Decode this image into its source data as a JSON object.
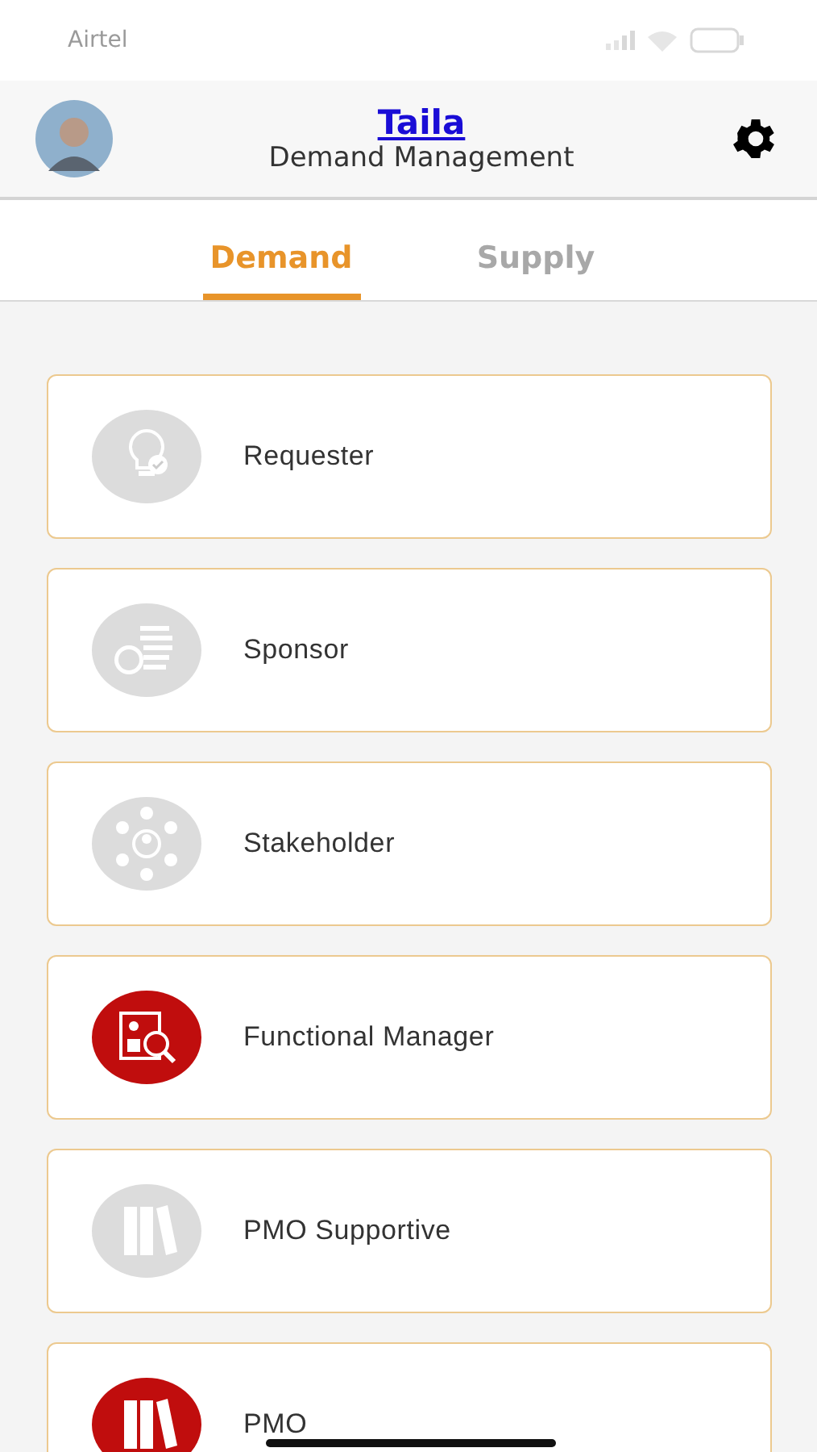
{
  "status_bar": {
    "carrier": "Airtel"
  },
  "header": {
    "user_name": "Taila",
    "subtitle": "Demand Management"
  },
  "tabs": [
    {
      "label": "Demand",
      "selected": true
    },
    {
      "label": "Supply",
      "selected": false
    }
  ],
  "roles": [
    {
      "label": "Requester",
      "kind": "bulb",
      "active": false
    },
    {
      "label": "Sponsor",
      "kind": "coins",
      "active": false
    },
    {
      "label": "Stakeholder",
      "kind": "people",
      "active": false
    },
    {
      "label": "Functional Manager",
      "kind": "report",
      "active": true
    },
    {
      "label": "PMO Supportive",
      "kind": "binders",
      "active": false
    },
    {
      "label": "PMO",
      "kind": "binders",
      "active": true
    }
  ]
}
